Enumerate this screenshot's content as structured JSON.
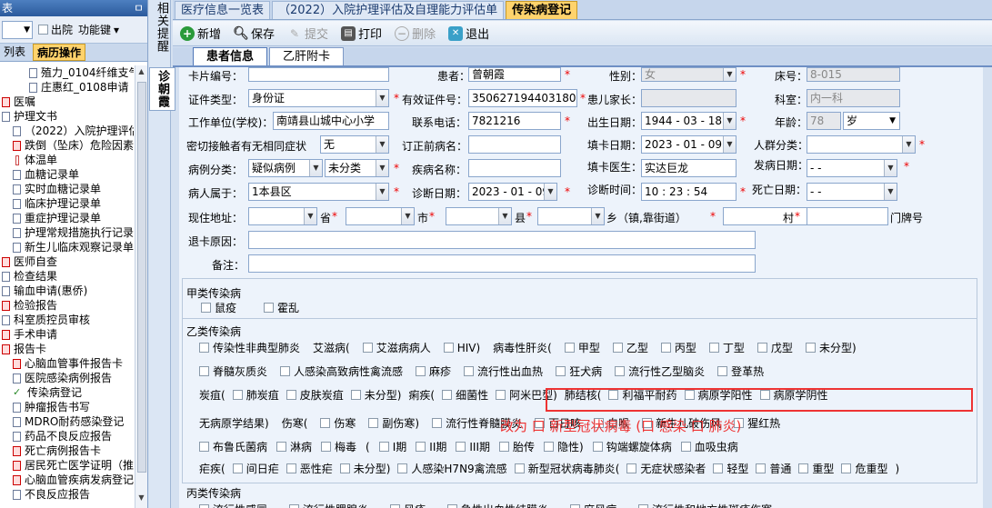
{
  "left_panel": {
    "title": "表",
    "pin": "ㅁ",
    "checkbox_out": "出院",
    "func_key": "功能键",
    "tabs": [
      "列表",
      "病历操作"
    ],
    "tree": [
      {
        "label": "殖力_0104纤维支气",
        "indent": 30
      },
      {
        "label": "庄惠红_0108申请",
        "indent": 30
      },
      {
        "label": "医嘱",
        "indent": 0
      },
      {
        "label": "护理文书",
        "indent": 0
      },
      {
        "label": "（2022）入院护理评估",
        "indent": 12
      },
      {
        "label": "跌倒（坠床）危险因素",
        "indent": 12
      },
      {
        "label": "体温单",
        "indent": 12
      },
      {
        "label": "血糖记录单",
        "indent": 12
      },
      {
        "label": "实时血糖记录单",
        "indent": 12
      },
      {
        "label": "临床护理记录单",
        "indent": 12
      },
      {
        "label": "重症护理记录单",
        "indent": 12
      },
      {
        "label": "护理常规措施执行记录",
        "indent": 12
      },
      {
        "label": "新生儿临床观察记录单",
        "indent": 12
      },
      {
        "label": "医师自查",
        "indent": 0
      },
      {
        "label": "检查结果",
        "indent": 0
      },
      {
        "label": "输血申请(惠侨)",
        "indent": 0
      },
      {
        "label": "检验报告",
        "indent": 0
      },
      {
        "label": "科室质控员审核",
        "indent": 0
      },
      {
        "label": "手术申请",
        "indent": 0
      },
      {
        "label": "报告卡",
        "indent": 0
      },
      {
        "label": "心脑血管事件报告卡",
        "indent": 12
      },
      {
        "label": "医院感染病例报告",
        "indent": 12
      },
      {
        "label": "传染病登记",
        "indent": 12
      },
      {
        "label": "肿瘤报告书写",
        "indent": 12
      },
      {
        "label": "MDRO耐药感染登记",
        "indent": 12
      },
      {
        "label": "药品不良反应报告",
        "indent": 12
      },
      {
        "label": "死亡病例报告卡",
        "indent": 12
      },
      {
        "label": "居民死亡医学证明（推",
        "indent": 12
      },
      {
        "label": "心脑血管疾病发病登记",
        "indent": 12
      },
      {
        "label": "不良反应报告",
        "indent": 12
      }
    ]
  },
  "vertical_strip": {
    "top": "相关提醒",
    "bottom": "诊朝霞"
  },
  "top_tabs": [
    "医疗信息一览表",
    "（2022）入院护理评估及自理能力评估单",
    "传染病登记"
  ],
  "toolbar": {
    "new": "新增",
    "save": "保存",
    "submit": "提交",
    "print": "打印",
    "delete": "删除",
    "exit": "退出"
  },
  "sub_tabs": [
    "患者信息",
    "乙肝附卡"
  ],
  "form": {
    "card_no_label": "卡片编号：",
    "patient_label": "患者：",
    "patient": "曾朝霞",
    "gender_label": "性别：",
    "gender": "女",
    "bed_label": "床号：",
    "bed": "8-015",
    "idtype_label": "证件类型：",
    "idtype": "身份证",
    "idno_label": "有效证件号：",
    "idno": "350627194403180028",
    "parent_label": "患儿家长：",
    "dept_label": "科室：",
    "dept": "内一科",
    "work_label": "工作单位(学校)：",
    "work": "南靖县山城中心小学",
    "phone_label": "联系电话：",
    "phone": "7821216",
    "birth_label": "出生日期：",
    "birth": "1944 - 03 - 18",
    "age_label": "年龄：",
    "age": "78",
    "age_unit": "岁",
    "contact_label": "密切接触者有无相同症状",
    "contact": "无",
    "revised_label": "订正前病名：",
    "filldate_label": "填卡日期：",
    "filldate": "2023 - 01 - 09",
    "crowd_label": "人群分类：",
    "casecat_label": "病例分类：",
    "casecat": "疑似病例",
    "casecat2": "未分类",
    "disease_label": "疾病名称：",
    "filldoc_label": "填卡医生：",
    "filldoc": "实达巨龙",
    "onset_label": "发病日期：",
    "onset": "-   -",
    "belong_label": "病人属于：",
    "belong": "1本县区",
    "diagdate_label": "诊断日期：",
    "diagdate": "2023 - 01 - 09",
    "diagtime_label": "诊断时间：",
    "diagtime": "10 : 23 : 54",
    "death_label": "死亡日期：",
    "death": "-   -",
    "addr_label": "现住地址：",
    "province": "省",
    "city": "市",
    "county": "县",
    "town": "乡（镇,靠街道）",
    "village": "村",
    "house": "门牌号",
    "reject_label": "退卡原因：",
    "note_label": "备注："
  },
  "class_a": {
    "title": "甲类传染病",
    "items": [
      "鼠疫",
      "霍乱"
    ]
  },
  "class_b": {
    "title": "乙类传染病",
    "row1": [
      "传染性非典型肺炎",
      "艾滋病(",
      "艾滋病病人",
      "HIV)",
      "病毒性肝炎(",
      "甲型",
      "乙型",
      "丙型",
      "丁型",
      "戊型",
      "未分型)"
    ],
    "row2": [
      "脊髓灰质炎",
      "人感染高致病性禽流感",
      "麻疹",
      "流行性出血热",
      "狂犬病",
      "流行性乙型脑炎",
      "登革热"
    ],
    "row3": [
      "炭疽(",
      "肺炭疽",
      "皮肤炭疽",
      "未分型)",
      "痢疾(",
      "细菌性",
      "阿米巴型)",
      "肺结核(",
      "利福平耐药",
      "病原学阳性",
      "病原学阴性"
    ],
    "row4": [
      "无病原学结果)",
      "伤寒(",
      "伤寒",
      "副伤寒)",
      "流行性脊髓膜炎",
      "百日咳",
      "白喉",
      "新生儿破伤风",
      "猩红热"
    ],
    "row5": [
      "布鲁氏菌病",
      "淋病",
      "梅毒",
      "(",
      "I期",
      "II期",
      "III期",
      "胎传",
      "隐性)",
      "钩端螺旋体病",
      "血吸虫病"
    ],
    "row6": [
      "疟疾(",
      "间日疟",
      "恶性疟",
      "未分型)",
      "人感染H7N9禽流感",
      "新型冠状病毒肺炎(",
      "无症状感染者",
      "轻型",
      "普通",
      "重型",
      "危重型",
      ")"
    ]
  },
  "class_c": {
    "title": "丙类传染病",
    "row": [
      "流行性感冒",
      "流行性腮腺炎",
      "风疹",
      "急性出血性结膜炎",
      "麻风病",
      "流行性和地方性斑疹伤寒"
    ]
  },
  "annotation": "改为  口 新型冠状病毒 (口 感染  口 肺炎)"
}
